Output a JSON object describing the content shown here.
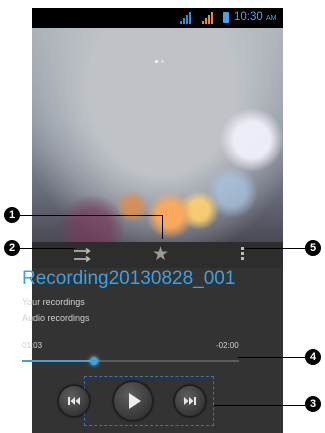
{
  "status_bar": {
    "time": "10:30",
    "ampm": "AM",
    "signal_colors": [
      "#2f8fd6",
      "#f08a24"
    ]
  },
  "player": {
    "track_title": "Recording20130828_001",
    "subtitle_1": "Your recordings",
    "subtitle_2": "Audio recordings",
    "time_elapsed": "01:03",
    "time_remaining": "-02:00",
    "progress_fraction": 0.33,
    "accent_color": "#3aa3e3"
  },
  "controls": {
    "prev_icon": "skip-previous-icon",
    "play_icon": "play-icon",
    "next_icon": "skip-next-icon",
    "shuffle_icon": "shuffle-icon",
    "favorite_icon": "star-icon",
    "more_icon": "more-vert-icon"
  },
  "callouts": [
    {
      "id": "1",
      "label": "1"
    },
    {
      "id": "2",
      "label": "2"
    },
    {
      "id": "3",
      "label": "3"
    },
    {
      "id": "4",
      "label": "4"
    },
    {
      "id": "5",
      "label": "5"
    }
  ]
}
